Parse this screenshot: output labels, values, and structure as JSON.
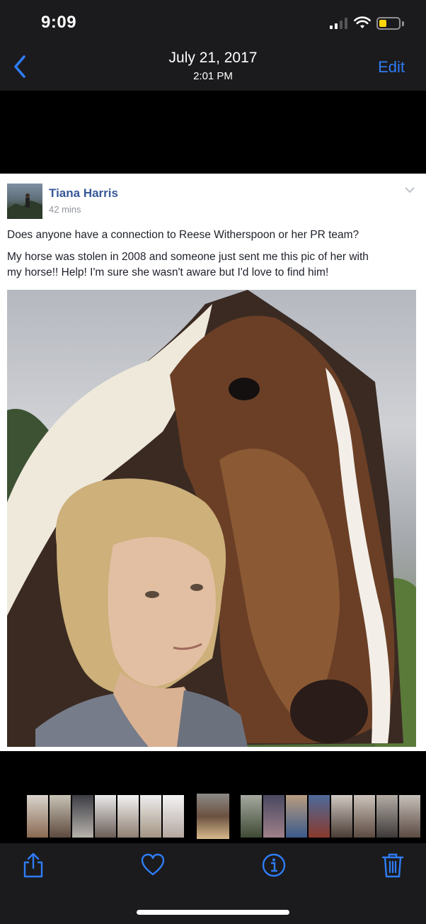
{
  "status_bar": {
    "time": "9:09"
  },
  "nav": {
    "date": "July 21, 2017",
    "time": "2:01 PM",
    "edit_label": "Edit",
    "accent_color": "#2f7cf6"
  },
  "post": {
    "author": "Tiana Harris",
    "time_ago": "42 mins",
    "text_line1": "Does anyone have a connection to Reese Witherspoon or her PR team?",
    "text_line2a": "My horse was stolen in 2008 and someone just sent me this pic of her with",
    "text_line2b": "my horse!! Help! I'm sure she wasn't aware but I'd love to find him!"
  },
  "toolbar": {
    "icons": [
      "share-icon",
      "heart-icon",
      "info-icon",
      "trash-icon"
    ]
  }
}
